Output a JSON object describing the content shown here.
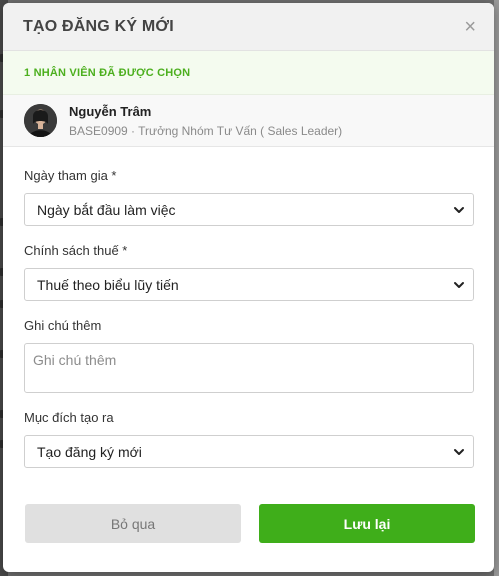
{
  "modal": {
    "title": "TẠO ĐĂNG KÝ MỚI",
    "close_symbol": "×"
  },
  "selection": {
    "banner_text": "1 NHÂN VIÊN ĐÃ ĐƯỢC CHỌN"
  },
  "employee": {
    "name": "Nguyễn Trâm",
    "subtitle": "BASE0909 · Trưởng Nhóm Tư Vấn ( Sales Leader)"
  },
  "form": {
    "join_date": {
      "label": "Ngày tham gia *",
      "value": "Ngày bắt đầu làm việc"
    },
    "tax_policy": {
      "label": "Chính sách thuế *",
      "value": "Thuế theo biểu lũy tiến"
    },
    "note": {
      "label": "Ghi chú thêm",
      "placeholder": "Ghi chú thêm"
    },
    "purpose": {
      "label": "Mục đích tạo ra",
      "value": "Tạo đăng ký mới"
    }
  },
  "actions": {
    "cancel_label": "Bỏ qua",
    "save_label": "Lưu lại"
  },
  "colors": {
    "accent_green": "#3fae1a",
    "banner_green_text": "#4caf1e"
  },
  "icons": {
    "close": "close-icon",
    "dropdown": "chevron-down-icon",
    "avatar": "avatar"
  }
}
